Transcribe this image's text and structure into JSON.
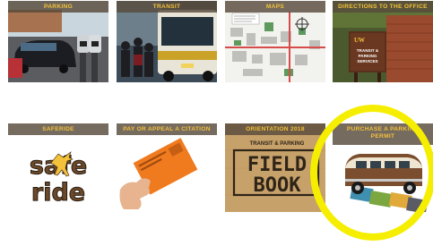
{
  "tiles": [
    {
      "id": "parking",
      "label": "PARKING"
    },
    {
      "id": "transit",
      "label": "TRANSIT"
    },
    {
      "id": "maps",
      "label": "MAPS"
    },
    {
      "id": "directions",
      "label": "DIRECTIONS TO THE OFFICE"
    },
    {
      "id": "saferide",
      "label": "SAFERIDE"
    },
    {
      "id": "citation",
      "label": "PAY OR APPEAL A CITATION"
    },
    {
      "id": "orientation",
      "label": "ORIENTATION 2018"
    },
    {
      "id": "purchase",
      "label": "PURCHASE A PARKING PERMIT"
    }
  ],
  "images": {
    "directions_sign": {
      "brand": "UW",
      "line1": "TRANSIT &",
      "line2": "PARKING",
      "line3": "SERVICES"
    },
    "saferide_logo": {
      "word1": "safe",
      "word2": "ride"
    },
    "field_book": {
      "header": "TRANSIT & PARKING",
      "line1": "FIELD",
      "line2": "BOOK"
    }
  },
  "colors": {
    "label_text": "#f3c13a",
    "label_bg": "#584a3c",
    "highlight_ring": "#f6ee00"
  }
}
